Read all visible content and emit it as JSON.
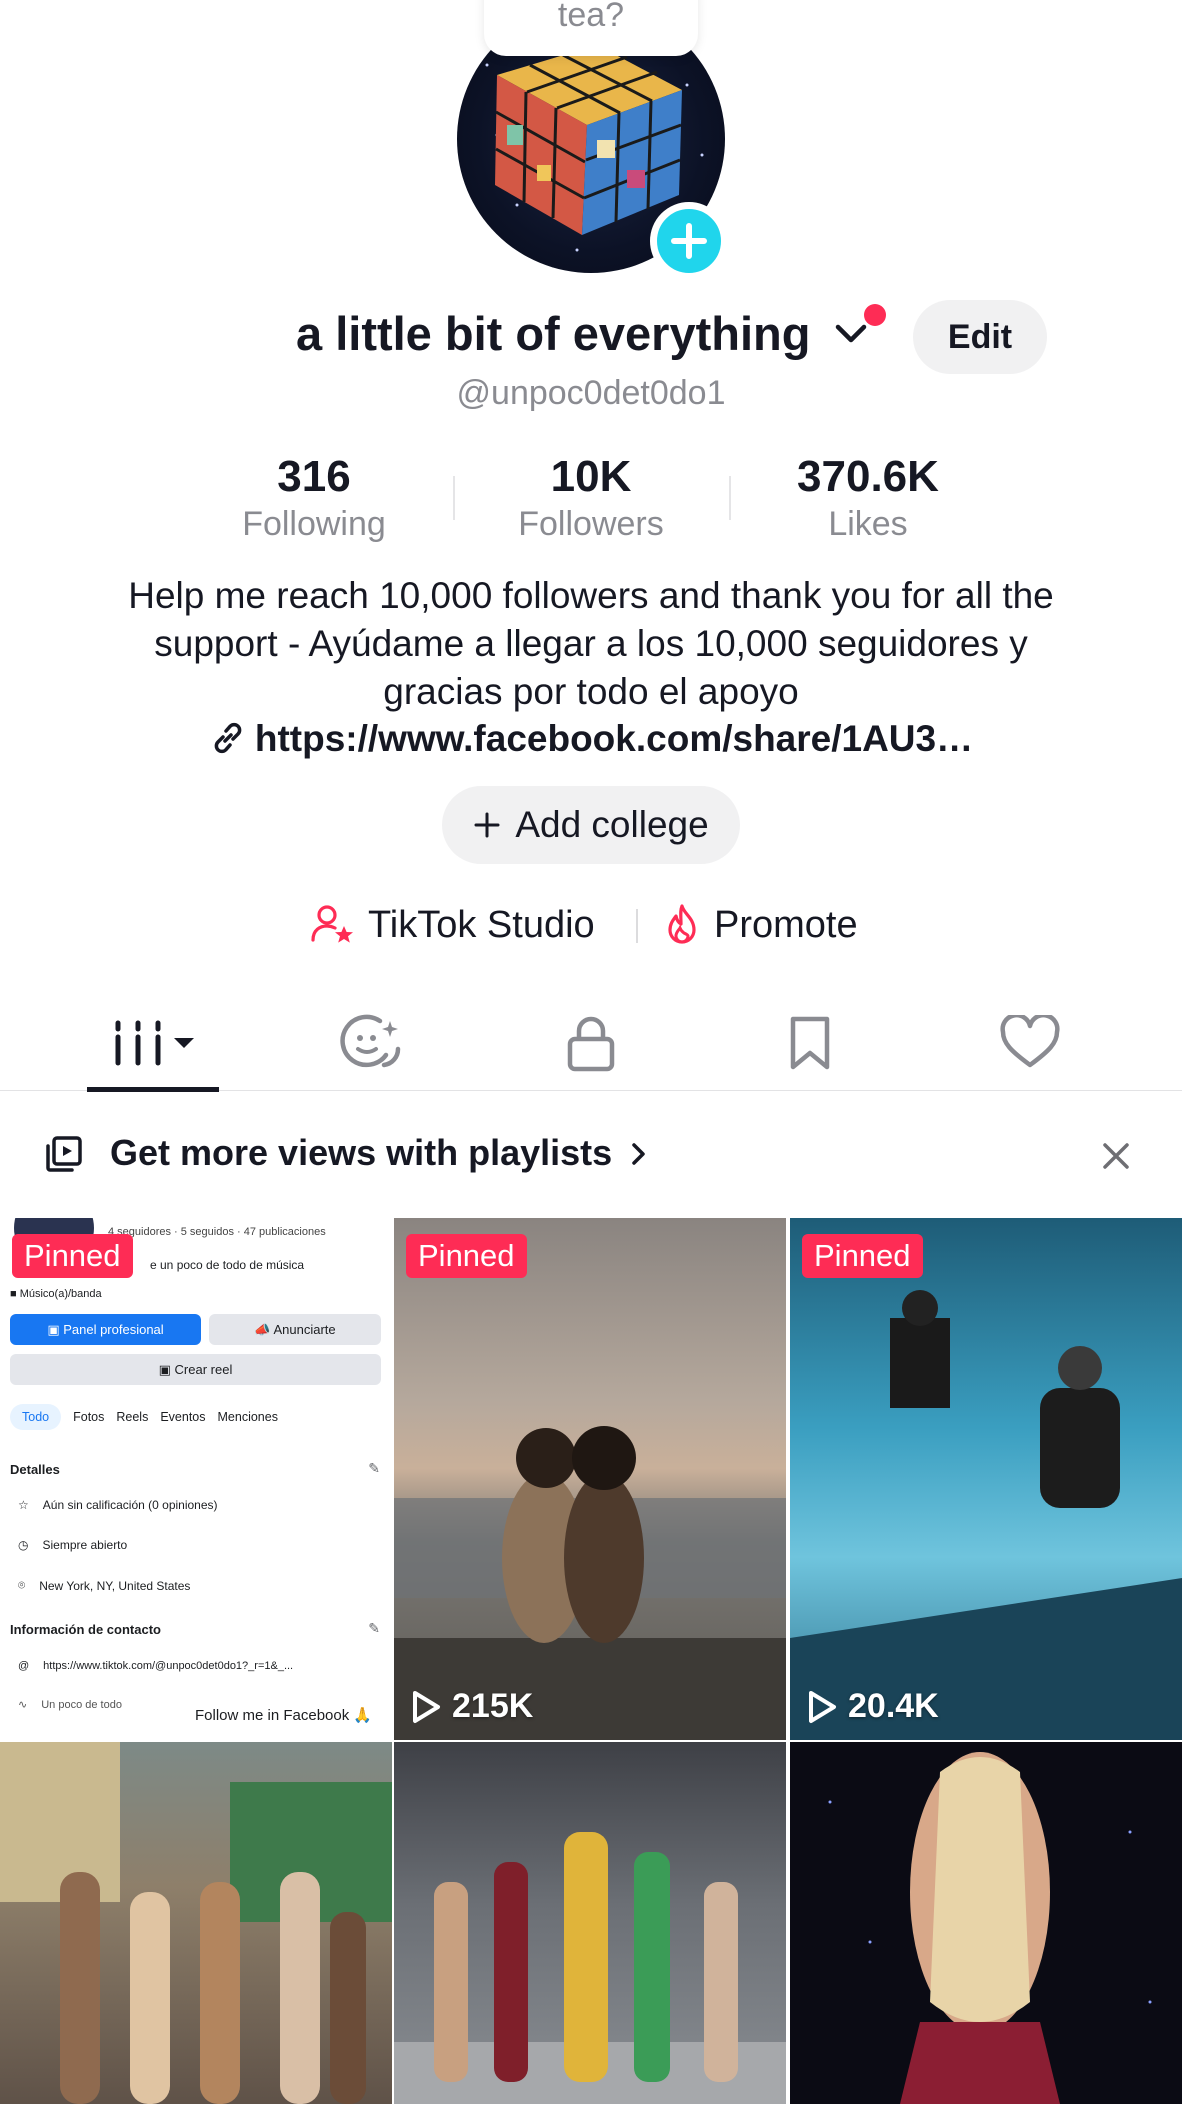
{
  "profile": {
    "bubble_text": "tea?",
    "display_name": "a little bit of everything",
    "edit_label": "Edit",
    "username": "@unpoc0det0do1",
    "stats": [
      {
        "value": "316",
        "label": "Following"
      },
      {
        "value": "10K",
        "label": "Followers"
      },
      {
        "value": "370.6K",
        "label": "Likes"
      }
    ],
    "bio": "Help me reach 10,000 followers and thank you for all the support - Ayúdame a llegar a los 10,000 seguidores y gracias por todo el apoyo",
    "link": "https://www.facebook.com/share/1AU3…",
    "add_college_label": "Add college",
    "tools": {
      "studio_label": "TikTok Studio",
      "promote_label": "Promote"
    }
  },
  "tabs": [
    "videos-grid-icon",
    "reposts-icon",
    "private-lock-icon",
    "favorites-bookmark-icon",
    "liked-heart-icon"
  ],
  "promo": {
    "text": "Get more views with playlists"
  },
  "videos": [
    {
      "pinned_label": "Pinned",
      "type": "facebook-screenshot",
      "fb": {
        "stats": "4 seguidores · 5 seguidos · 47 publicaciones",
        "desc": "e un poco de todo de música",
        "category": "Músico(a)/banda",
        "btn_panel": "Panel profesional",
        "btn_ad": "Anunciarte",
        "btn_reel": "Crear reel",
        "tabs": [
          "Todo",
          "Fotos",
          "Reels",
          "Eventos",
          "Menciones"
        ],
        "details_title": "Detalles",
        "details": [
          "Aún sin calificación (0 opiniones)",
          "Siempre abierto",
          "New York, NY, United States"
        ],
        "contact_title": "Información de contacto",
        "contact": [
          "https://www.tiktok.com/@unpoc0det0do1?_r=1&_...",
          "Un poco de todo"
        ],
        "overlay": "Follow me in Facebook 🙏"
      }
    },
    {
      "pinned_label": "Pinned",
      "views": "215K"
    },
    {
      "pinned_label": "Pinned",
      "views": "20.4K"
    },
    {},
    {},
    {}
  ],
  "colors": {
    "accent": "#fe2c55",
    "avatar_plus": "#20d5ec",
    "text": "#161823",
    "muted": "#8a8b91"
  }
}
